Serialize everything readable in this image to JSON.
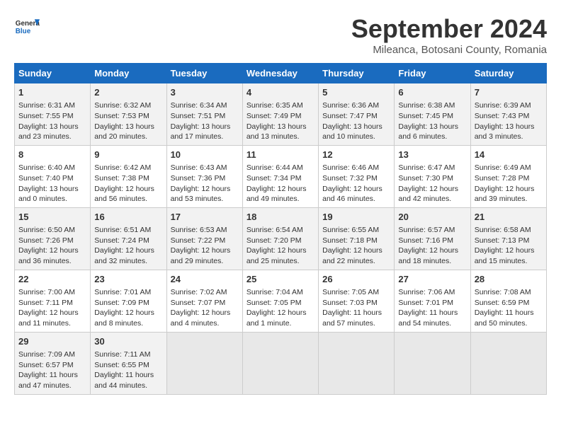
{
  "header": {
    "logo_line1": "General",
    "logo_line2": "Blue",
    "month": "September 2024",
    "location": "Mileanca, Botosani County, Romania"
  },
  "days_of_week": [
    "Sunday",
    "Monday",
    "Tuesday",
    "Wednesday",
    "Thursday",
    "Friday",
    "Saturday"
  ],
  "weeks": [
    [
      {
        "day": "1",
        "sunrise": "6:31 AM",
        "sunset": "7:55 PM",
        "daylight": "13 hours and 23 minutes."
      },
      {
        "day": "2",
        "sunrise": "6:32 AM",
        "sunset": "7:53 PM",
        "daylight": "13 hours and 20 minutes."
      },
      {
        "day": "3",
        "sunrise": "6:34 AM",
        "sunset": "7:51 PM",
        "daylight": "13 hours and 17 minutes."
      },
      {
        "day": "4",
        "sunrise": "6:35 AM",
        "sunset": "7:49 PM",
        "daylight": "13 hours and 13 minutes."
      },
      {
        "day": "5",
        "sunrise": "6:36 AM",
        "sunset": "7:47 PM",
        "daylight": "13 hours and 10 minutes."
      },
      {
        "day": "6",
        "sunrise": "6:38 AM",
        "sunset": "7:45 PM",
        "daylight": "13 hours and 6 minutes."
      },
      {
        "day": "7",
        "sunrise": "6:39 AM",
        "sunset": "7:43 PM",
        "daylight": "13 hours and 3 minutes."
      }
    ],
    [
      {
        "day": "8",
        "sunrise": "6:40 AM",
        "sunset": "7:40 PM",
        "daylight": "13 hours and 0 minutes."
      },
      {
        "day": "9",
        "sunrise": "6:42 AM",
        "sunset": "7:38 PM",
        "daylight": "12 hours and 56 minutes."
      },
      {
        "day": "10",
        "sunrise": "6:43 AM",
        "sunset": "7:36 PM",
        "daylight": "12 hours and 53 minutes."
      },
      {
        "day": "11",
        "sunrise": "6:44 AM",
        "sunset": "7:34 PM",
        "daylight": "12 hours and 49 minutes."
      },
      {
        "day": "12",
        "sunrise": "6:46 AM",
        "sunset": "7:32 PM",
        "daylight": "12 hours and 46 minutes."
      },
      {
        "day": "13",
        "sunrise": "6:47 AM",
        "sunset": "7:30 PM",
        "daylight": "12 hours and 42 minutes."
      },
      {
        "day": "14",
        "sunrise": "6:49 AM",
        "sunset": "7:28 PM",
        "daylight": "12 hours and 39 minutes."
      }
    ],
    [
      {
        "day": "15",
        "sunrise": "6:50 AM",
        "sunset": "7:26 PM",
        "daylight": "12 hours and 36 minutes."
      },
      {
        "day": "16",
        "sunrise": "6:51 AM",
        "sunset": "7:24 PM",
        "daylight": "12 hours and 32 minutes."
      },
      {
        "day": "17",
        "sunrise": "6:53 AM",
        "sunset": "7:22 PM",
        "daylight": "12 hours and 29 minutes."
      },
      {
        "day": "18",
        "sunrise": "6:54 AM",
        "sunset": "7:20 PM",
        "daylight": "12 hours and 25 minutes."
      },
      {
        "day": "19",
        "sunrise": "6:55 AM",
        "sunset": "7:18 PM",
        "daylight": "12 hours and 22 minutes."
      },
      {
        "day": "20",
        "sunrise": "6:57 AM",
        "sunset": "7:16 PM",
        "daylight": "12 hours and 18 minutes."
      },
      {
        "day": "21",
        "sunrise": "6:58 AM",
        "sunset": "7:13 PM",
        "daylight": "12 hours and 15 minutes."
      }
    ],
    [
      {
        "day": "22",
        "sunrise": "7:00 AM",
        "sunset": "7:11 PM",
        "daylight": "12 hours and 11 minutes."
      },
      {
        "day": "23",
        "sunrise": "7:01 AM",
        "sunset": "7:09 PM",
        "daylight": "12 hours and 8 minutes."
      },
      {
        "day": "24",
        "sunrise": "7:02 AM",
        "sunset": "7:07 PM",
        "daylight": "12 hours and 4 minutes."
      },
      {
        "day": "25",
        "sunrise": "7:04 AM",
        "sunset": "7:05 PM",
        "daylight": "12 hours and 1 minute."
      },
      {
        "day": "26",
        "sunrise": "7:05 AM",
        "sunset": "7:03 PM",
        "daylight": "11 hours and 57 minutes."
      },
      {
        "day": "27",
        "sunrise": "7:06 AM",
        "sunset": "7:01 PM",
        "daylight": "11 hours and 54 minutes."
      },
      {
        "day": "28",
        "sunrise": "7:08 AM",
        "sunset": "6:59 PM",
        "daylight": "11 hours and 50 minutes."
      }
    ],
    [
      {
        "day": "29",
        "sunrise": "7:09 AM",
        "sunset": "6:57 PM",
        "daylight": "11 hours and 47 minutes."
      },
      {
        "day": "30",
        "sunrise": "7:11 AM",
        "sunset": "6:55 PM",
        "daylight": "11 hours and 44 minutes."
      },
      null,
      null,
      null,
      null,
      null
    ]
  ]
}
